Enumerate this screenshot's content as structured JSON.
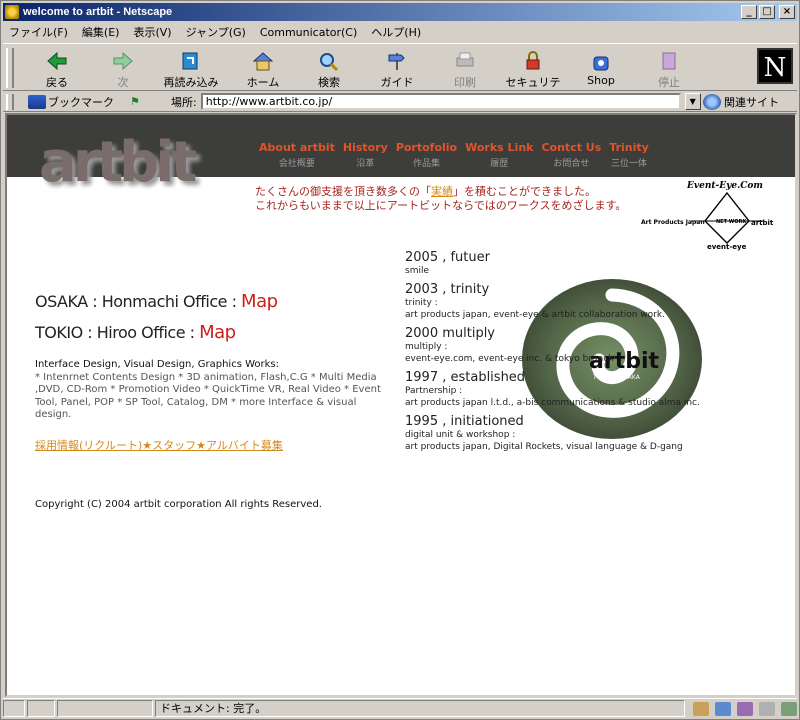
{
  "window": {
    "title": "welcome to artbit - Netscape",
    "min_btn": "_",
    "max_btn": "□",
    "close_btn": "×"
  },
  "menu": [
    "ファイル(F)",
    "編集(E)",
    "表示(V)",
    "ジャンプ(G)",
    "Communicator(C)",
    "ヘルプ(H)"
  ],
  "toolbar": {
    "back": "戻る",
    "forward": "次",
    "reload": "再読み込み",
    "home": "ホーム",
    "search": "検索",
    "guide": "ガイド",
    "print": "印刷",
    "security": "セキュリティ",
    "shop": "Shop",
    "stop": "停止",
    "logo": "N"
  },
  "locbar": {
    "bookmarks": "ブックマーク",
    "location_label": "場所:",
    "url": "http://www.artbit.co.jp/",
    "related": "関連サイト"
  },
  "page": {
    "logo": "artbit",
    "nav": [
      {
        "en": "About artbit",
        "jp": "会社概要"
      },
      {
        "en": "History",
        "jp": "沿革"
      },
      {
        "en": "Portofolio",
        "jp": "作品集"
      },
      {
        "en": "Works Link",
        "jp": "履歴"
      },
      {
        "en": "Contct Us",
        "jp": "お問合せ"
      },
      {
        "en": "Trinity",
        "jp": "三位一体"
      }
    ],
    "message": {
      "line1_pre": "たくさんの御支援を頂き数多くの「",
      "line1_link": "実績",
      "line1_post": "」を積むことができました。",
      "line2": "これからもいままで以上にアートビットならではのワークスをめざします。"
    },
    "partner": {
      "event_eye": "Event-Eye.Com",
      "art_products": "Art Products Japan",
      "network": "NET WORK",
      "artbit": "artbit",
      "event_eye_bottom": "event-eye"
    },
    "offices": [
      {
        "label": "OSAKA : Honmachi Office : ",
        "map": "Map"
      },
      {
        "label": "TOKIO : Hiroo Office : ",
        "map": "Map"
      }
    ],
    "works_title": "Interface Design, Visual Design, Graphics Works:",
    "works_body": "* Intenrnet Contents Design * 3D animation, Flash,C.G * Multi Media ,DVD, CD-Rom * Promotion Video * QuickTime VR, Real Video * Event Tool, Panel, POP * SP Tool, Catalog, DM * more Interface & visual design.",
    "recruit": "採用情報(リクルート)★スタッフ★アルバイト募集",
    "copyright": "Copyright (C) 2004 artbit corporation All rights Reserved.",
    "history": [
      {
        "year": "2005 , futuer",
        "label": "smile",
        "detail": ""
      },
      {
        "year": "2003 , trinity",
        "label": "trinity :",
        "detail": "art products japan, event-eye & artbit collaboration work."
      },
      {
        "year": "2000 multiply",
        "label": "multiply :",
        "detail": "event-eye.com, event-eye inc. & tokyo branch"
      },
      {
        "year": "1997 , established",
        "label": "Partnership :",
        "detail": "art products japan l.t.d., a-bis communications & studio alma inc."
      },
      {
        "year": "1995 , initiationed",
        "label": "digital unit & workshop :",
        "detail": "art products japan, Digital Rockets, visual language & D-gang"
      }
    ],
    "spiral_logo": "artbit",
    "spiral_sub": "TOKYO - OSAKA"
  },
  "status": {
    "text": "ドキュメント: 完了。"
  }
}
